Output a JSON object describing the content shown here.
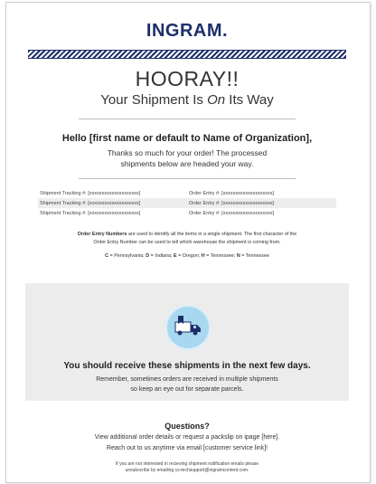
{
  "brand": {
    "logo": "INGRAM."
  },
  "hero": {
    "title": "HOORAY!!",
    "subtitle_pre": "Your Shipment Is ",
    "subtitle_em": "On",
    "subtitle_post": " Its Way"
  },
  "greeting": {
    "title": "Hello [first name or default to Name of Organization],",
    "line1": "Thanks so much for your order! The processed",
    "line2": "shipments below are headed your way."
  },
  "tracking": {
    "rows": [
      {
        "tracking": "Shipment Tracking #: [xxxxxxxxxxxxxxxxxxxx]",
        "order": "Order Entry #: [xxxxxxxxxxxxxxxxxxxx]"
      },
      {
        "tracking": "Shipment Tracking #: [xxxxxxxxxxxxxxxxxxxx]",
        "order": "Order Entry #: [xxxxxxxxxxxxxxxxxxxx]"
      },
      {
        "tracking": "Shipment Tracking #: [xxxxxxxxxxxxxxxxxxxx]",
        "order": "Order Entry #: [xxxxxxxxxxxxxxxxxxxx]"
      }
    ]
  },
  "note": {
    "bold": "Order Entry Numbers",
    "text1": " are used to identify all the items in a single shipment. The first character of the",
    "text2": "Order Entry Number can be used to tell which warehouse the shipment is coming from."
  },
  "states": [
    {
      "code": "C",
      "name": "Pennsylvania"
    },
    {
      "code": "D",
      "name": "Indiana"
    },
    {
      "code": "E",
      "name": "Oregon"
    },
    {
      "code": "H",
      "name": "Tennessee"
    },
    {
      "code": "N",
      "name": "Tennessee"
    }
  ],
  "promo": {
    "title": "You should receive these shipments in the next few days.",
    "line1": "Remember, sometimes orders are received in multiple shipments",
    "line2": "so keep an eye out for separate parcels."
  },
  "footer": {
    "title": "Questions?",
    "line1": "View additional order details or request a packslip on ipage [here].",
    "line2": "Reach out to us anytime via email [customer service link]!",
    "small1": "If you are not interested in recieving shipment notification emails please",
    "small2": "unsubscribe by emailing cs-techsupport@ingramcontent.com."
  },
  "colors": {
    "brand_navy": "#1d2f6b",
    "truck_circle": "#a8d8f0",
    "promo_bg": "#ececed"
  }
}
